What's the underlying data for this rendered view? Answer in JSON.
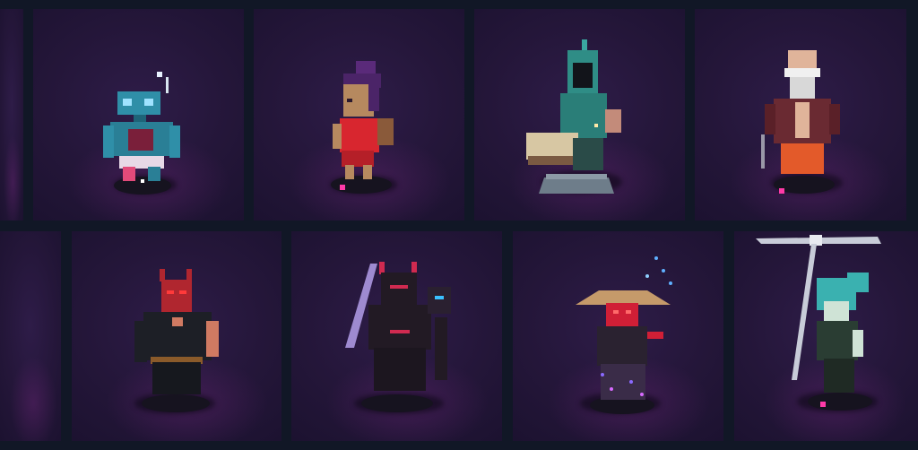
{
  "gallery": {
    "background": "#111726",
    "tile_background": "#241639",
    "rows": [
      {
        "tiles": [
          {
            "subject": "partial-tile"
          },
          {
            "subject": "robot-character",
            "palette": [
              "#2f8fa8",
              "#e24a7a",
              "#f2e9ef"
            ]
          },
          {
            "subject": "purple-haired-girl-character",
            "palette": [
              "#5a2a7a",
              "#d8262f",
              "#b6895f"
            ]
          },
          {
            "subject": "hooded-bird-character",
            "palette": [
              "#2f8d86",
              "#7a5a42",
              "#6e7d8a"
            ]
          },
          {
            "subject": "bald-bearded-man-character",
            "palette": [
              "#6a2a32",
              "#e0b49a",
              "#e35a2a"
            ]
          }
        ]
      },
      {
        "tiles": [
          {
            "subject": "partial-tile"
          },
          {
            "subject": "horned-masked-warrior-character",
            "palette": [
              "#b0262f",
              "#1d1f26",
              "#d07a62"
            ]
          },
          {
            "subject": "dark-armored-knight-character",
            "palette": [
              "#221a24",
              "#d02a50",
              "#9e8ad0"
            ]
          },
          {
            "subject": "straw-hat-ronin-character",
            "palette": [
              "#c59a6a",
              "#d01f36",
              "#5fb0ff"
            ]
          },
          {
            "subject": "teal-haired-scythe-character",
            "palette": [
              "#3ab1b0",
              "#2a3d33",
              "#c8ccd8"
            ]
          }
        ]
      }
    ]
  }
}
